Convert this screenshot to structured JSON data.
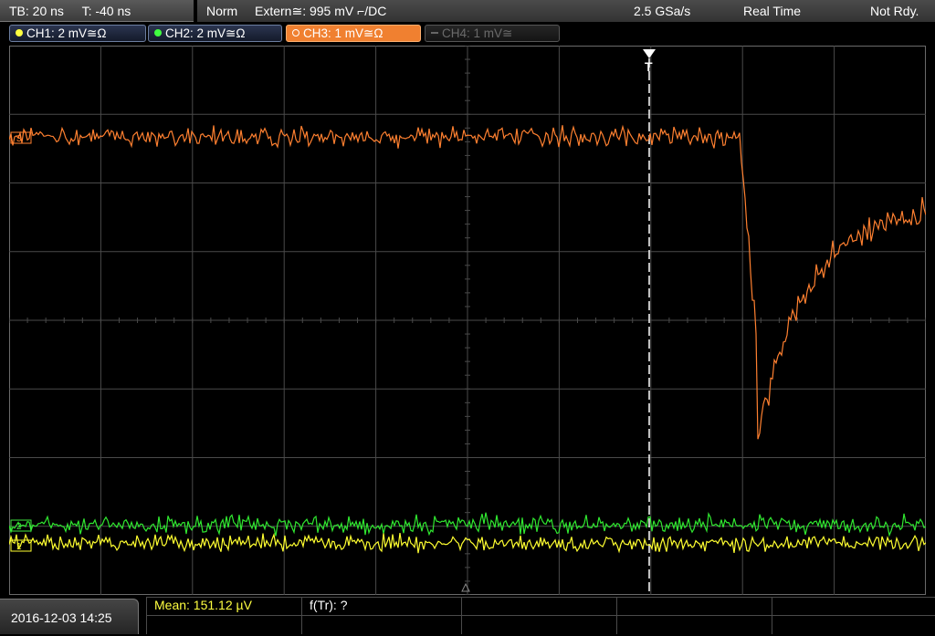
{
  "timebase": {
    "tb": "TB: 20 ns",
    "trigger_time": "T: -40 ns"
  },
  "trigger": {
    "mode": "Norm",
    "source": "Extern≅: 995 mV ⌐/DC",
    "sample_rate": "2.5 GSa/s",
    "acq_mode": "Real Time",
    "status": "Not Rdy."
  },
  "channels": [
    {
      "label": "CH1: 2 mV≅Ω",
      "color": "#ffff40",
      "state": "on"
    },
    {
      "label": "CH2: 2 mV≅Ω",
      "color": "#40ff40",
      "state": "on"
    },
    {
      "label": "CH3: 1 mV≅Ω",
      "color": "#ff8030",
      "state": "active"
    },
    {
      "label": "CH4: 1 mV≅",
      "color": "#7f7f7f",
      "state": "off"
    }
  ],
  "markers": {
    "ch3": "3",
    "ch2": "2",
    "ch1": "1",
    "trigger": "T"
  },
  "footer": {
    "datetime": "2016-12-03 14:25",
    "measurement_1": "Mean: 151.12 µV",
    "measurement_2": "f(Tr): ?"
  },
  "colors": {
    "ch1": "#ffff30",
    "ch2": "#30e830",
    "ch3": "#ff8030",
    "grid": "#4a4a4a",
    "background": "#000000"
  }
}
